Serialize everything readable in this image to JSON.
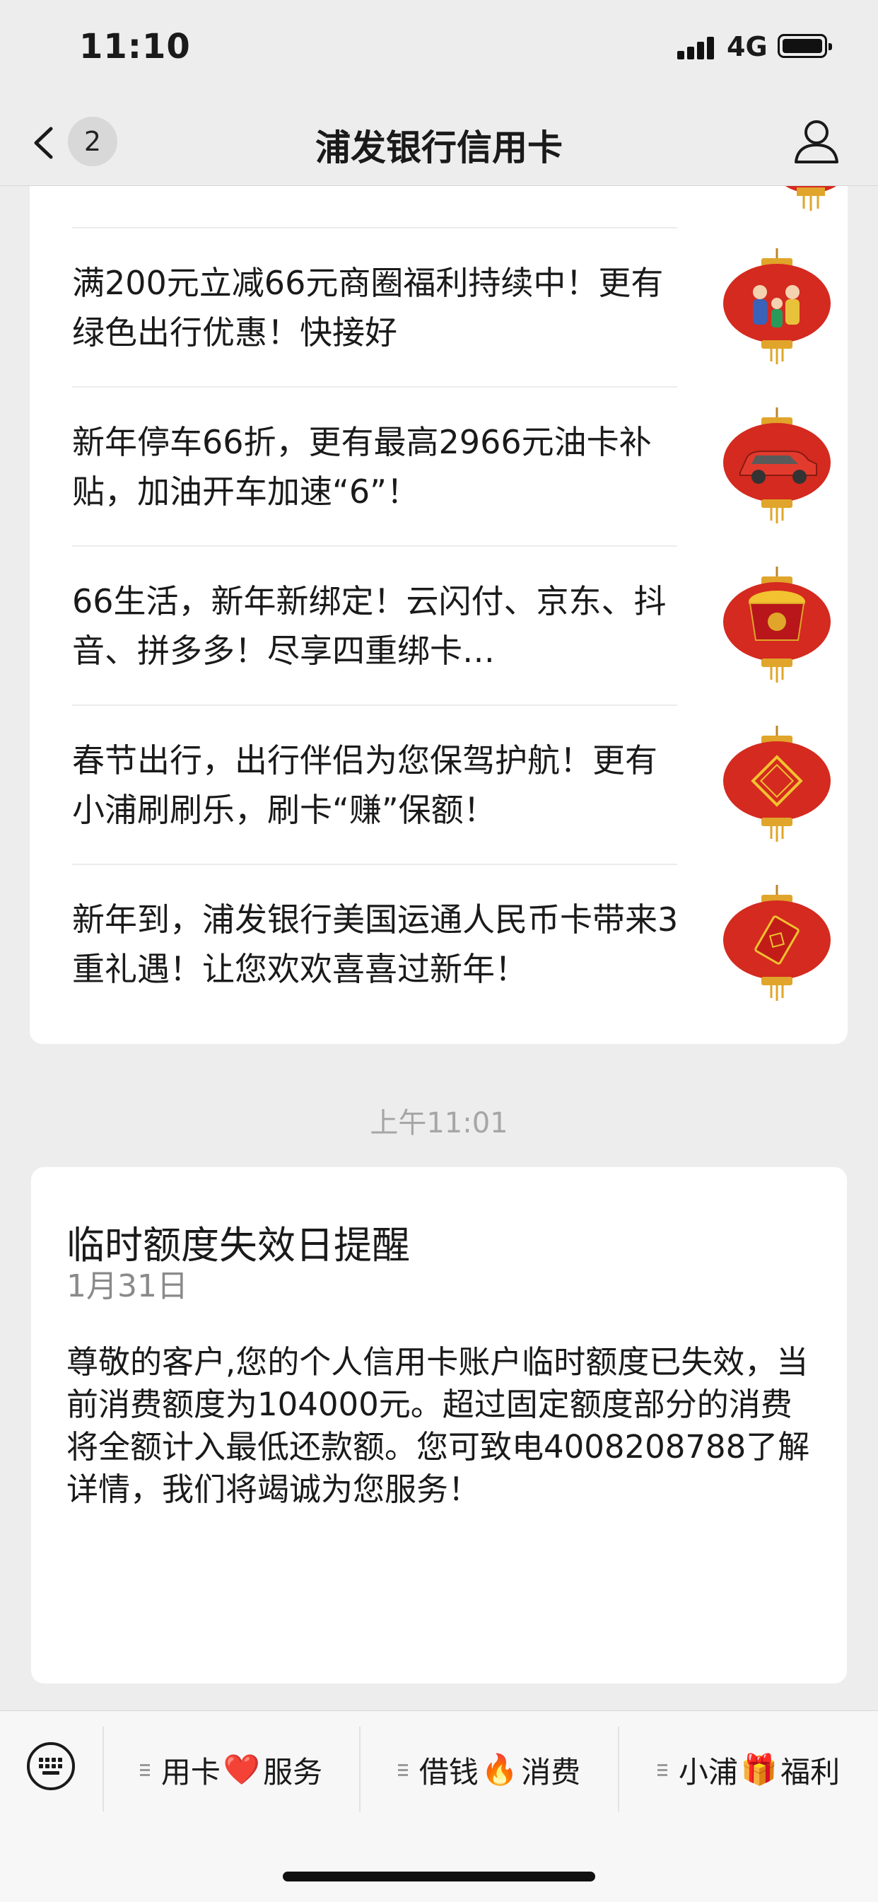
{
  "status_bar": {
    "time": "11:10",
    "network": "4G"
  },
  "nav": {
    "badge_count": "2",
    "title": "浦发银行信用卡"
  },
  "articles": [
    {
      "text": "满200元立减66元商圈福利持续中！更有绿色出行优惠！快接好",
      "thumb_icon": "lantern-family-icon"
    },
    {
      "text": "新年停车66折，更有最高2966元油卡补贴，加油开车加速“6”！",
      "thumb_icon": "lantern-car-icon"
    },
    {
      "text": "66生活，新年新绑定！云闪付、京东、抖音、拼多多！尽享四重绑卡…",
      "thumb_icon": "lantern-gold-icon"
    },
    {
      "text": "春节出行，出行伴侣为您保驾护航！更有小浦刷刷乐，刷卡“赚”保额！",
      "thumb_icon": "lantern-fu-icon"
    },
    {
      "text": "新年到，浦发银行美国运通人民币卡带来3重礼遇！让您欢欢喜喜过新年！",
      "thumb_icon": "lantern-envelope-icon"
    }
  ],
  "timestamp": "上午11:01",
  "message": {
    "title": "临时额度失效日提醒",
    "date": "1月31日",
    "body": "尊敬的客户,您的个人信用卡账户临时额度已失效，当前消费额度为104000元。超过固定额度部分的消费将全额计入最低还款额。您可致电4008208788了解详情，我们将竭诚为您服务！"
  },
  "menu": [
    {
      "left": "用卡",
      "emoji": "❤️",
      "right": "服务"
    },
    {
      "left": "借钱",
      "emoji": "🔥",
      "right": "消费"
    },
    {
      "left": "小浦",
      "emoji": "🎁",
      "right": "福利"
    }
  ],
  "colors": {
    "lantern": "#d42a1f",
    "lantern_gold": "#e0a52a",
    "background": "#ededed"
  }
}
